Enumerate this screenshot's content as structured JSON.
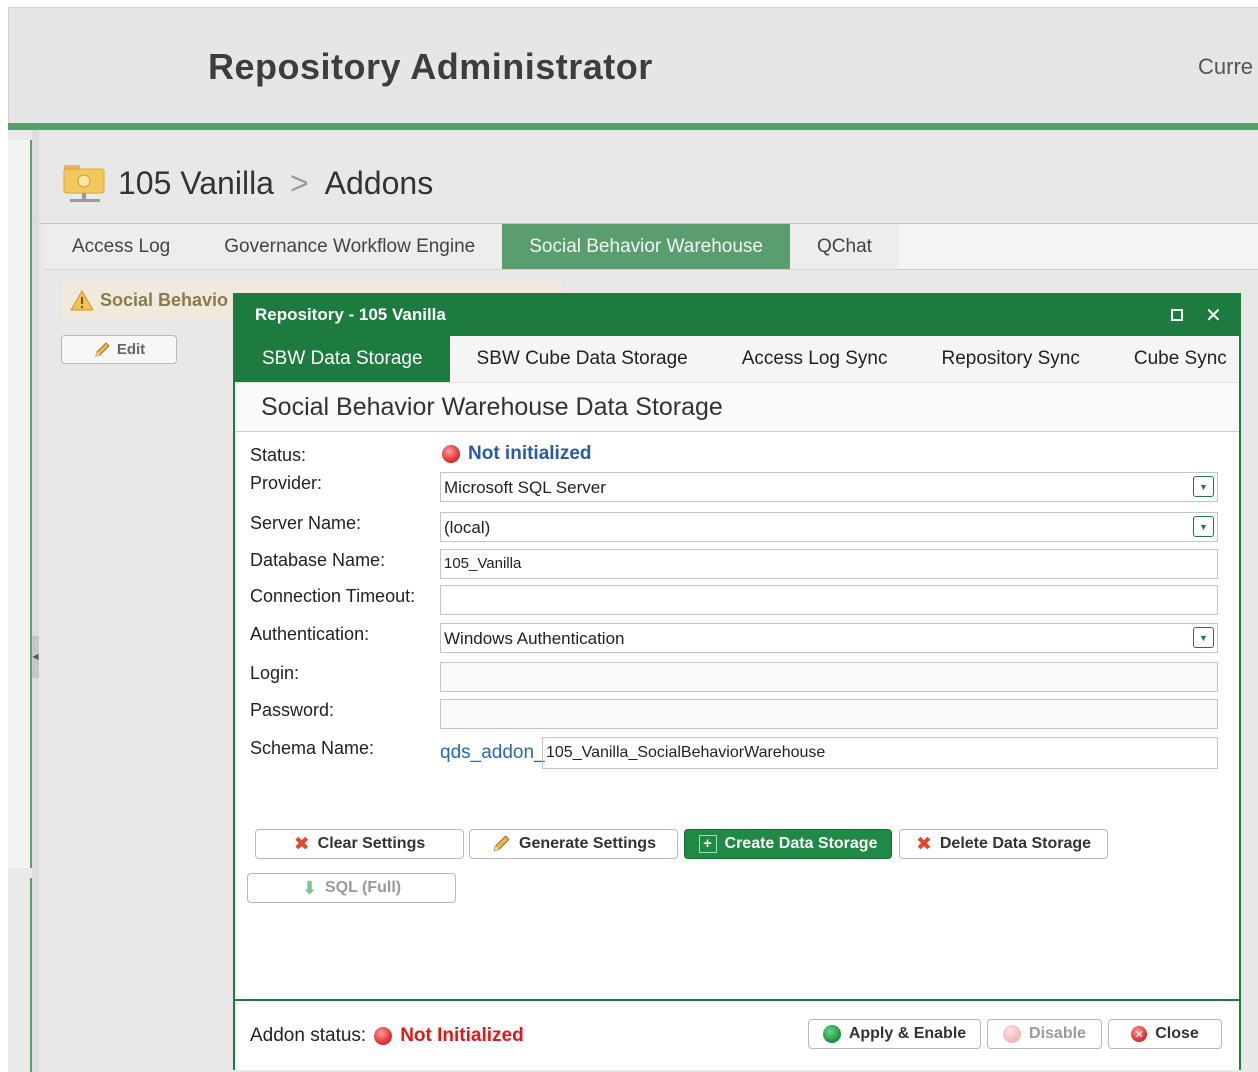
{
  "app": {
    "title": "Repository Administrator",
    "current_label": "Curre"
  },
  "breadcrumb": {
    "repo": "105 Vanilla",
    "separator": ">",
    "page": "Addons"
  },
  "tabs": [
    {
      "label": "Access Log"
    },
    {
      "label": "Governance Workflow Engine"
    },
    {
      "label": "Social Behavior Warehouse"
    },
    {
      "label": "QChat"
    }
  ],
  "warning": {
    "text": "Social Behavio"
  },
  "edit_button": {
    "label": "Edit"
  },
  "dialog": {
    "title": "Repository - 105 Vanilla",
    "tabs": [
      {
        "label": "SBW Data Storage"
      },
      {
        "label": "SBW Cube Data Storage"
      },
      {
        "label": "Access Log Sync"
      },
      {
        "label": "Repository Sync"
      },
      {
        "label": "Cube Sync"
      }
    ],
    "section_title": "Social Behavior Warehouse Data Storage",
    "form": {
      "status_label": "Status:",
      "status_value": "Not initialized",
      "provider_label": "Provider:",
      "provider_value": "Microsoft SQL Server",
      "server_label": "Server Name:",
      "server_value": "(local)",
      "database_label": "Database Name:",
      "database_value": "105_Vanilla",
      "timeout_label": "Connection Timeout:",
      "timeout_value": "",
      "auth_label": "Authentication:",
      "auth_value": "Windows Authentication",
      "login_label": "Login:",
      "login_value": "",
      "password_label": "Password:",
      "password_value": "",
      "schema_label": "Schema Name:",
      "schema_prefix": "qds_addon_",
      "schema_value": "105_Vanilla_SocialBehaviorWarehouse"
    },
    "buttons": {
      "clear": "Clear Settings",
      "generate": "Generate Settings",
      "create": "Create Data Storage",
      "delete": "Delete Data Storage",
      "sql": "SQL (Full)"
    },
    "footer": {
      "addon_status_label": "Addon status:",
      "addon_status_value": "Not Initialized",
      "apply": "Apply & Enable",
      "disable": "Disable",
      "close": "Close"
    }
  },
  "colors": {
    "accent": "#1e7b40",
    "tab_active": "#5a9e6f",
    "error": "#e01818",
    "link": "#2a5aa8"
  }
}
